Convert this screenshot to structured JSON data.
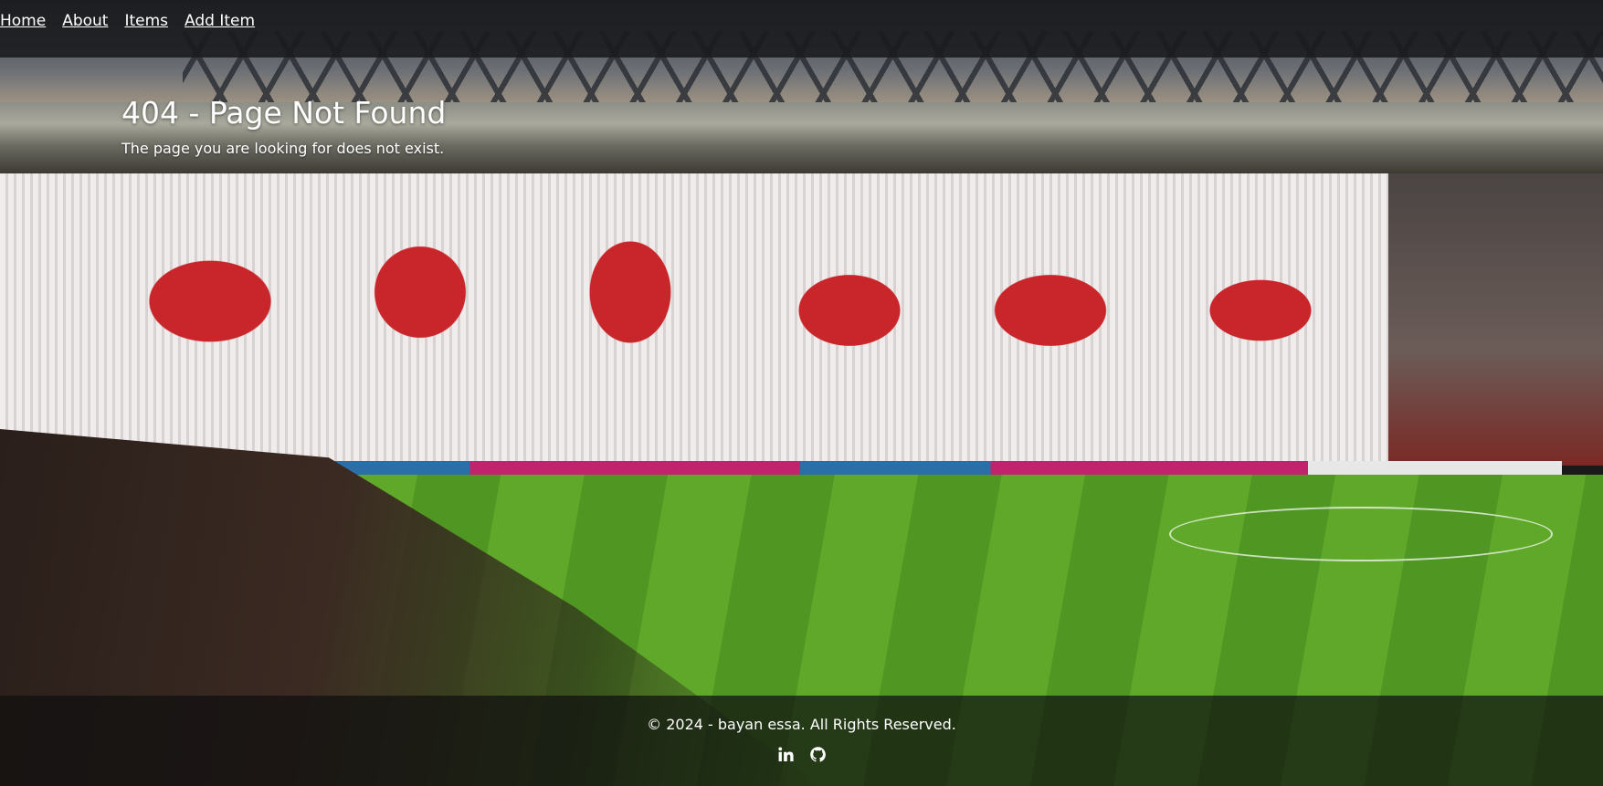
{
  "nav": {
    "items": [
      {
        "label": "Home"
      },
      {
        "label": "About"
      },
      {
        "label": "Items"
      },
      {
        "label": "Add Item"
      }
    ]
  },
  "hero": {
    "title": "404 - Page Not Found",
    "message": "The page you are looking for does not exist."
  },
  "footer": {
    "copyright": "© 2024 - bayan essa. All Rights Reserved.",
    "icons": [
      "linkedin-icon",
      "github-icon"
    ]
  },
  "colors": {
    "text": "#ffffff",
    "nav_bg": "#191a1c",
    "footer_bg": "#0f0f0f"
  }
}
